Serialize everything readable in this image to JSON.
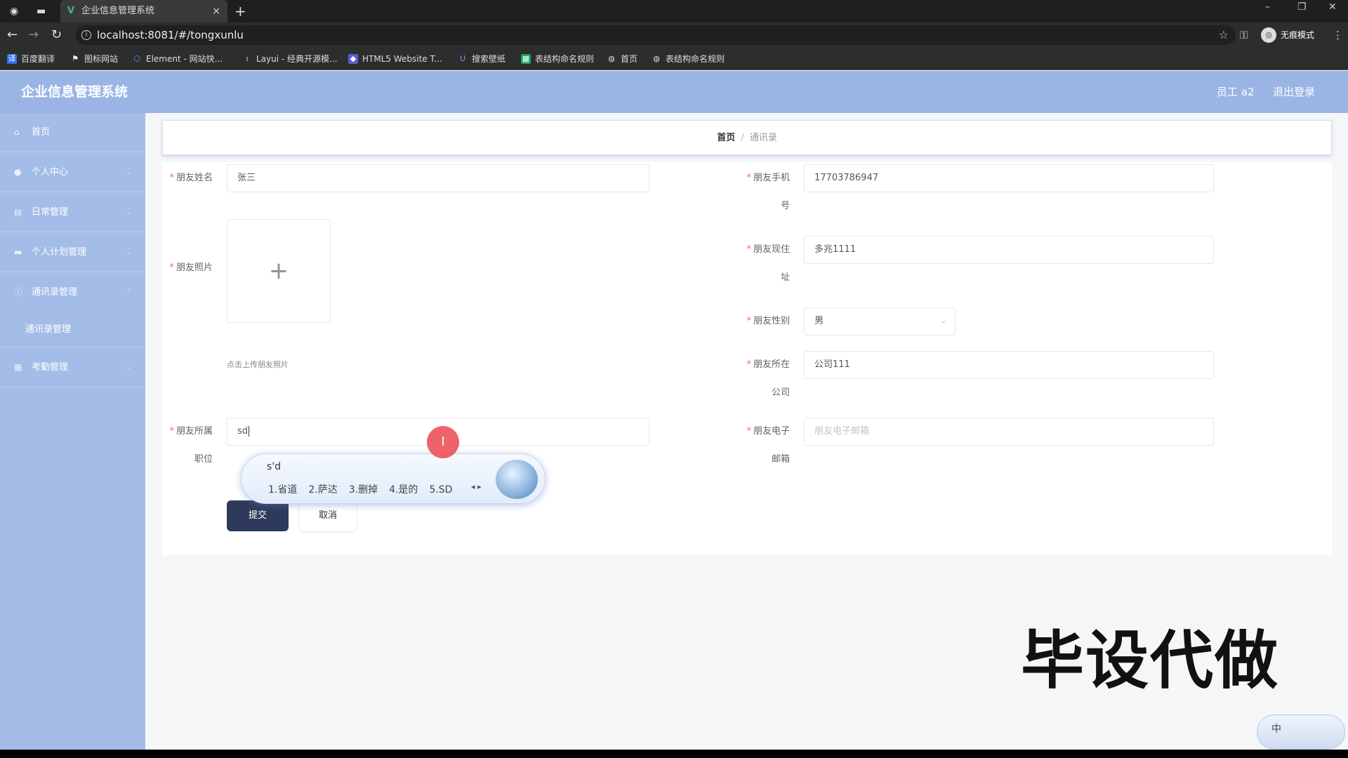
{
  "browser": {
    "tab_title": "企业信息管理系统",
    "tab_close": "×",
    "new_tab": "+",
    "url": "localhost:8081/#/tongxunlu",
    "incognito_label": "无痕模式",
    "bookmarks": [
      "百度翻译",
      "图标网站",
      "Element - 网站快...",
      "Layui - 经典开源模...",
      "HTML5 Website T...",
      "搜索壁纸",
      "表结构命名规则",
      "首页",
      "表结构命名规则"
    ]
  },
  "app": {
    "title": "企业信息管理系统",
    "user": "员工 a2",
    "logout": "退出登录"
  },
  "sidebar": {
    "items": [
      "首页",
      "个人中心",
      "日常管理",
      "个人计划管理",
      "通讯录管理"
    ],
    "submenu": "通讯录管理",
    "last_item": "考勤管理"
  },
  "breadcrumb": {
    "home": "首页",
    "separator": "/",
    "current": "通讯录"
  },
  "form": {
    "name_label": "朋友姓名",
    "name_value": "张三",
    "photo_label": "朋友照片",
    "photo_plus": "+",
    "photo_hint": "点击上传朋友照片",
    "position_label_1": "朋友所属",
    "position_label_2": "职位",
    "position_value": "sd",
    "phone_label_1": "朋友手机",
    "phone_label_2": "号",
    "phone_value": "17703786947",
    "address_label_1": "朋友现住",
    "address_label_2": "址",
    "address_value": "多兆1111",
    "gender_label": "朋友性别",
    "gender_value": "男",
    "company_label_1": "朋友所在",
    "company_label_2": "公司",
    "company_value": "公司111",
    "email_label_1": "朋友电子",
    "email_label_2": "邮箱",
    "email_placeholder": "朋友电子邮箱",
    "required_mark": "*",
    "submit": "提交",
    "cancel": "取消"
  },
  "ime": {
    "composition": "s'd",
    "candidates": [
      "1.省道",
      "2.萨达",
      "3.删掉",
      "4.是的",
      "5.SD"
    ]
  },
  "overlay": {
    "watermark": "毕设代做",
    "tray_label": "中"
  }
}
